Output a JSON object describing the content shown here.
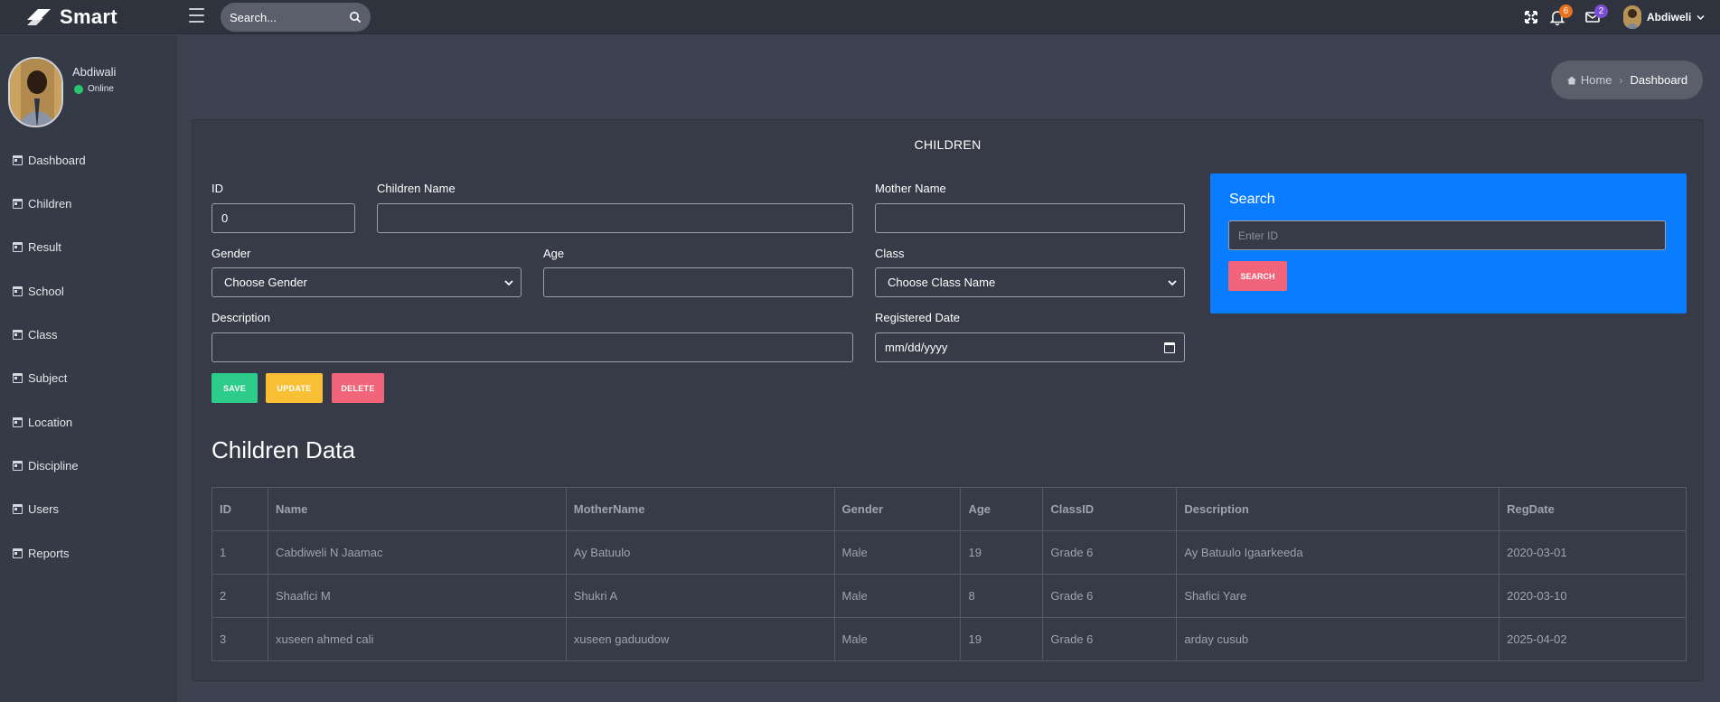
{
  "topbar": {
    "brand": "Smart",
    "search_placeholder": "Search...",
    "notifications_count": "6",
    "messages_count": "2",
    "user_name": "Abdiweli",
    "colors": {
      "notif_badge": "#e8711b",
      "msg_badge": "#7b4cd6"
    }
  },
  "sidebar": {
    "profile_name": "Abdiwali",
    "status": "Online",
    "items": [
      {
        "label": "Dashboard"
      },
      {
        "label": "Children"
      },
      {
        "label": "Result"
      },
      {
        "label": "School"
      },
      {
        "label": "Class"
      },
      {
        "label": "Subject"
      },
      {
        "label": "Location"
      },
      {
        "label": "Discipline"
      },
      {
        "label": "Users"
      },
      {
        "label": "Reports"
      }
    ]
  },
  "breadcrumb": {
    "home": "Home",
    "current": "Dashboard"
  },
  "form": {
    "title": "CHILDREN",
    "id_label": "ID",
    "id_value": "0",
    "name_label": "Children Name",
    "mother_label": "Mother Name",
    "gender_label": "Gender",
    "gender_value": "Choose Gender",
    "age_label": "Age",
    "class_label": "Class",
    "class_value": "Choose Class Name",
    "description_label": "Description",
    "regdate_label": "Registered Date",
    "regdate_value": "mm/dd/yyyy",
    "save": "SAVE",
    "update": "UPDATE",
    "delete": "DELETE"
  },
  "search_panel": {
    "title": "Search",
    "placeholder": "Enter ID",
    "button": "SEARCH"
  },
  "table": {
    "title": "Children Data",
    "headers": [
      "ID",
      "Name",
      "MotherName",
      "Gender",
      "Age",
      "ClassID",
      "Description",
      "RegDate"
    ],
    "rows": [
      [
        "1",
        "Cabdiweli N Jaamac",
        "Ay Batuulo",
        "Male",
        "19",
        "Grade 6",
        "Ay Batuulo Igaarkeeda",
        "2020-03-01"
      ],
      [
        "2",
        "Shaafici M",
        "Shukri A",
        "Male",
        "8",
        "Grade 6",
        "Shafici Yare",
        "2020-03-10"
      ],
      [
        "3",
        "xuseen ahmed cali",
        "xuseen gaduudow",
        "Male",
        "19",
        "Grade 6",
        "arday cusub",
        "2025-04-02"
      ]
    ]
  }
}
